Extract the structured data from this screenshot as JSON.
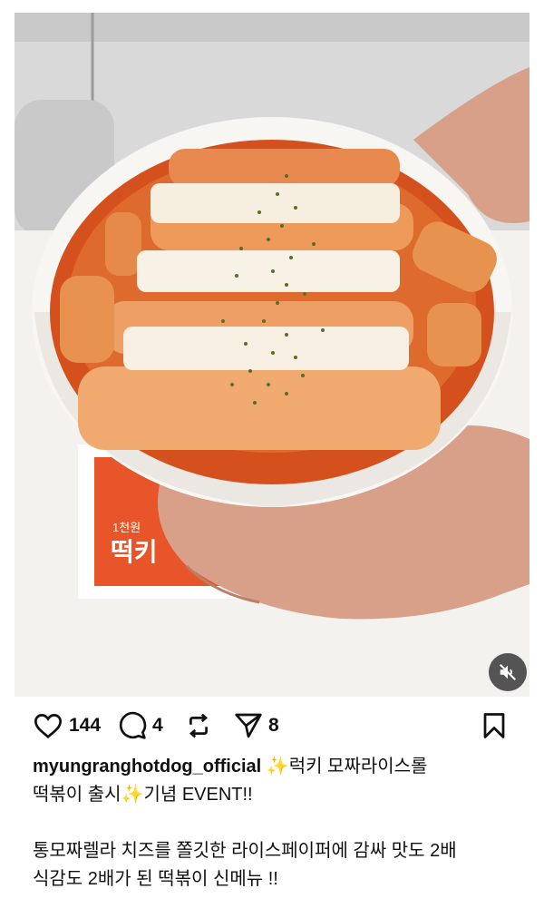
{
  "post": {
    "media": {
      "type": "video",
      "description_icon": "speaker-muted-icon",
      "sign_text": "떡키",
      "sign_subtext": "1천원"
    },
    "actions": {
      "like": {
        "icon": "heart-icon",
        "count": "144"
      },
      "comment": {
        "icon": "comment-icon",
        "count": "4"
      },
      "repost": {
        "icon": "repost-icon",
        "count": ""
      },
      "share": {
        "icon": "send-icon",
        "count": "8"
      },
      "save": {
        "icon": "bookmark-icon"
      }
    },
    "caption": {
      "username": "myungranghotdog_official",
      "line1_a": "✨",
      "line1_b": "럭키 모짜라이스롤",
      "line2_a": "떡볶이 출시",
      "line2_b": "✨",
      "line2_c": "기념 EVENT!!",
      "para2_line1": "통모짜렐라 치즈를 쫄깃한 라이스페이퍼에 감싸 맛도 2배",
      "para2_line2": "식감도 2배가 된 떡볶이 신메뉴 !!"
    }
  },
  "colors": {
    "sauce": "#d8541f",
    "bowl": "#f7f5f2",
    "sign": "#e8552a",
    "skin": "#d9a089"
  }
}
